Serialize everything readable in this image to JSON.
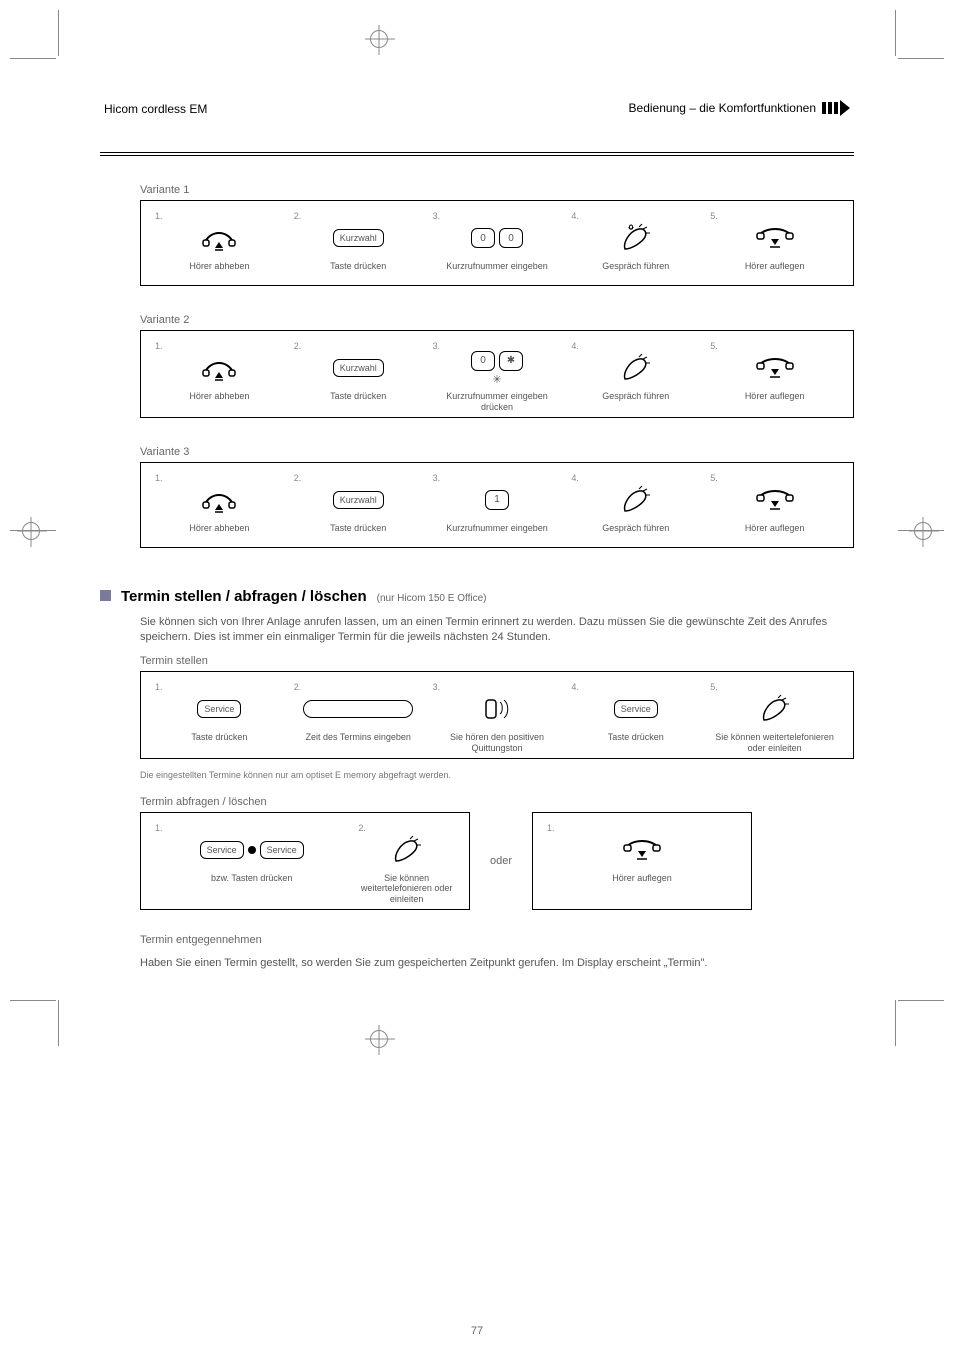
{
  "header": {
    "left": "Hicom cordless EM",
    "right": "Bedienung – die Komfortfunktionen"
  },
  "variant1": {
    "label": "Variante 1",
    "steps": {
      "s1": "Hörer abheben",
      "s2": "Taste drücken",
      "s2key": "Kurzwahl",
      "s3": "Kurzrufnummer eingeben",
      "s3key1": "0",
      "s3key2": "0",
      "s4": "Gespräch führen",
      "s5": "Hörer auflegen"
    }
  },
  "variant2": {
    "label": "Variante 2",
    "steps": {
      "s1": "Hörer abheben",
      "s2": "Taste drücken",
      "s2key": "Kurzwahl",
      "s3a": "Kurzrufnummer eingeben",
      "s3b": "drücken",
      "s3key1": "0",
      "s4": "Gespräch führen",
      "s5": "Hörer auflegen"
    }
  },
  "variant3": {
    "label": "Variante 3",
    "steps": {
      "s1": "Hörer abheben",
      "s2": "Taste drücken",
      "s2key": "Kurzwahl",
      "s3": "Kurzrufnummer eingeben",
      "s3key": "1",
      "s4": "Gespräch führen",
      "s5": "Hörer auflegen"
    }
  },
  "section": {
    "title": "Termin stellen / abfragen / löschen",
    "code": "(nur Hicom 150 E Office)",
    "intro": "Sie können sich von Ihrer Anlage anrufen lassen, um an einen Termin erinnert zu werden. Dazu müssen Sie die gewünschte Zeit des Anrufes speichern. Dies ist immer ein einmaliger Termin für die jeweils nächsten 24 Stunden.",
    "set_label": "Termin stellen",
    "query_label": "Termin abfragen / löschen",
    "or": "oder"
  },
  "setbox": {
    "s1": "Taste drücken",
    "s1key": "Service",
    "s2": "Zeit des Termins eingeben",
    "s3": "Sie hören den positiven Quittungston",
    "s4": "Taste drücken",
    "s4key": "Service",
    "s5": "Sie können weitertelefonieren oder einleiten"
  },
  "querybox": {
    "s1a": "bzw.",
    "s1akey1": "Service",
    "s1akey2": "Service",
    "s1b": "Tasten drücken",
    "s2": "Sie können weitertelefonieren oder einleiten"
  },
  "hangupbox": {
    "s1": "Hörer auflegen"
  },
  "page_num": "77",
  "note": "Die eingestellten Termine können nur am optiset E memory abgefragt werden.",
  "termin_section": {
    "t1": "Termin entgegennehmen",
    "t2": "Haben Sie einen Termin gestellt, so werden Sie zum gespeicherten Zeitpunkt gerufen. Im Display erscheint „Termin\"."
  }
}
